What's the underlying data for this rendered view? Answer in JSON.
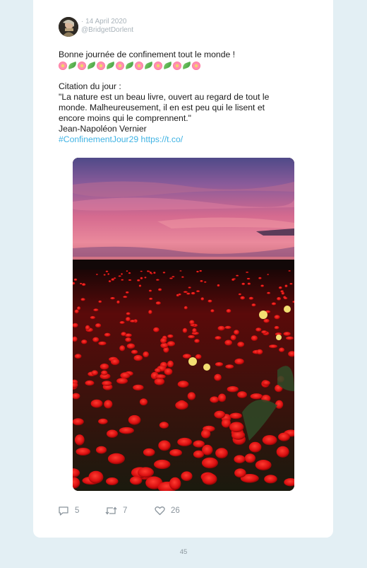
{
  "tweet": {
    "date": "· 14 April 2020",
    "handle": "@BridgetDorlent",
    "line1": "Bonne journée de confinement tout le monde !",
    "emoji_pattern": [
      "flower",
      "leaf",
      "flower",
      "leaf",
      "flower",
      "leaf",
      "flower",
      "leaf",
      "flower",
      "leaf",
      "flower",
      "leaf",
      "flower",
      "leaf",
      "flower"
    ],
    "quote_title": "Citation du jour :",
    "quote_line1": "\"La nature est un beau livre, ouvert au regard de tout le",
    "quote_line2": "monde. Malheureusement, il en est peu qui le lisent et",
    "quote_line3": "encore moins qui le comprennent.\"",
    "author": "Jean-Napoléon Vernier",
    "hashtag": "#ConfinementJour29",
    "url": "https://t.co/"
  },
  "actions": {
    "replies": "5",
    "retweets": "7",
    "likes": "26"
  },
  "page_number": "45",
  "colors": {
    "background": "#e3eff4",
    "card": "#ffffff",
    "link": "#3fb3e4",
    "muted": "#a9b3ba"
  }
}
